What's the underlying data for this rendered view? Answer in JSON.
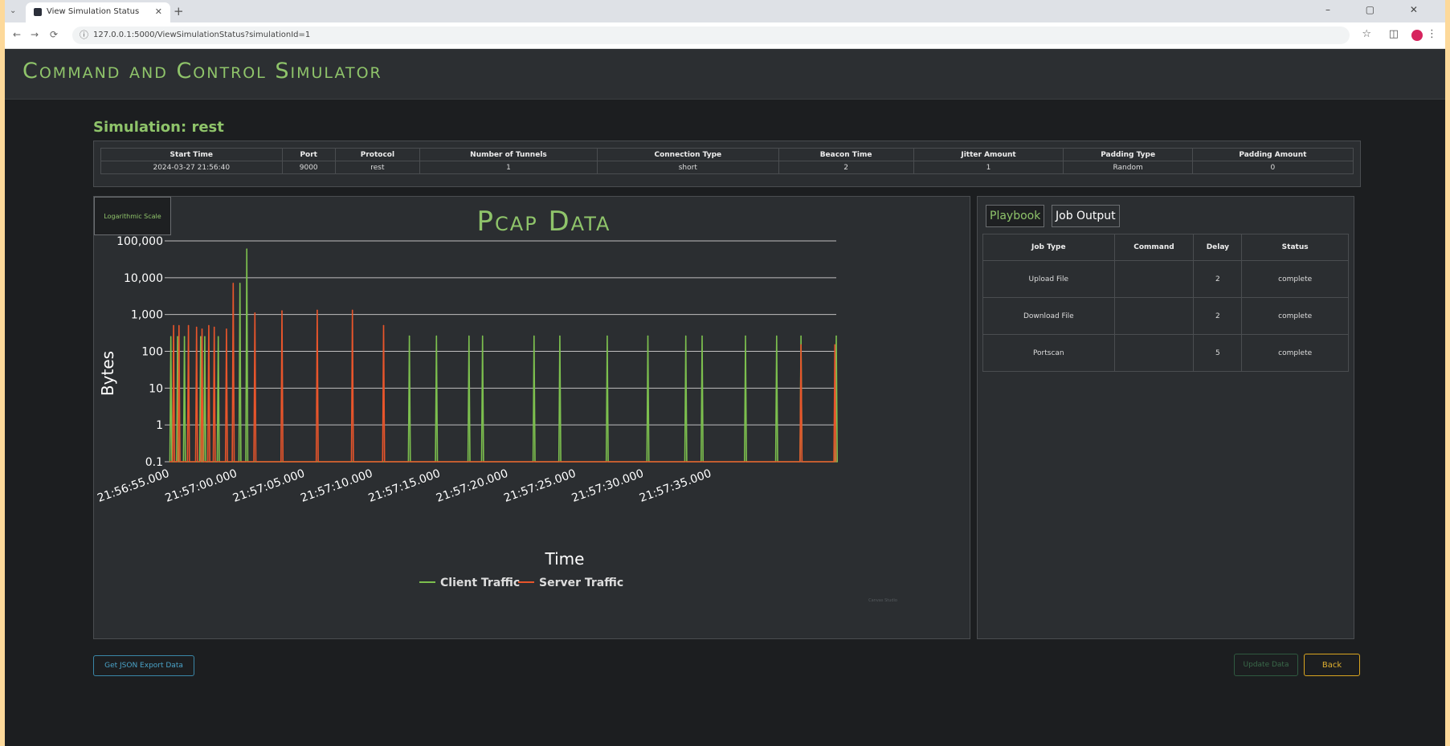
{
  "browser": {
    "tab_title": "View Simulation Status",
    "tab_close": "✕",
    "new_tab": "+",
    "window_controls": "–  ▢  ✕",
    "url": "127.0.0.1:5000/ViewSimulationStatus?simulationId=1",
    "nav": {
      "back": "←",
      "forward": "→",
      "reload": "⟳",
      "info": "ⓘ",
      "star": "☆",
      "sidebar": "◫",
      "menu": "⋮"
    }
  },
  "app": {
    "title": "Command and Control Simulator"
  },
  "simulation": {
    "title": "Simulation: rest",
    "headers": [
      "Start Time",
      "Port",
      "Protocol",
      "Number of Tunnels",
      "Connection Type",
      "Beacon Time",
      "Jitter Amount",
      "Padding Type",
      "Padding Amount"
    ],
    "row": [
      "2024-03-27 21:56:40",
      "9000",
      "rest",
      "1",
      "short",
      "2",
      "1",
      "Random",
      "0"
    ]
  },
  "chart_panel": {
    "log_button": "Logarithmic Scale",
    "watermark": "Canvas Studio"
  },
  "chart_data": {
    "type": "line",
    "title": "Pcap Data",
    "xlabel": "Time",
    "ylabel": "Bytes",
    "yscale": "log",
    "ylim": [
      0.1,
      100000
    ],
    "y_ticks": [
      "100,000",
      "10,000",
      "1,000",
      "100",
      "10",
      "1",
      "0.1"
    ],
    "x_ticks": [
      "21:56:55.000",
      "21:57:00.000",
      "21:57:05.000",
      "21:57:10.000",
      "21:57:15.000",
      "21:57:20.000",
      "21:57:25.000",
      "21:57:30.000",
      "21:57:35.000"
    ],
    "x_tick_seconds": [
      55,
      60,
      65,
      70,
      75,
      80,
      85,
      90,
      95
    ],
    "xlim_seconds": [
      55.2,
      104.4
    ],
    "legend": "bottom-center",
    "grid": true,
    "series": [
      {
        "name": "Client Traffic",
        "color": "#7cbf4e",
        "x_seconds": [
          55.3,
          55.8,
          56.3,
          57.5,
          57.8,
          58.8,
          60.4,
          60.9,
          72.9,
          74.9,
          77.3,
          78.3,
          82.1,
          84.0,
          87.5,
          90.5,
          93.3,
          94.5,
          97.7,
          100.0,
          101.8,
          104.4
        ],
        "y": [
          250,
          250,
          250,
          250,
          250,
          250,
          7000,
          60000,
          260,
          260,
          260,
          260,
          260,
          260,
          260,
          260,
          260,
          260,
          260,
          260,
          260,
          260
        ]
      },
      {
        "name": "Server Traffic",
        "color": "#e8552b",
        "x_seconds": [
          55.5,
          55.9,
          56.6,
          57.2,
          57.6,
          58.1,
          58.5,
          59.4,
          59.9,
          61.5,
          63.5,
          66.1,
          68.7,
          71.0,
          101.8,
          104.3
        ],
        "y": [
          500,
          500,
          500,
          450,
          400,
          500,
          450,
          400,
          7000,
          1100,
          1250,
          1300,
          1300,
          500,
          150,
          150
        ]
      }
    ]
  },
  "playbook": {
    "tabs": [
      "Playbook",
      "Job Output"
    ],
    "headers": [
      "Job Type",
      "Command",
      "Delay",
      "Status"
    ],
    "rows": [
      [
        "Upload File",
        "",
        "2",
        "complete"
      ],
      [
        "Download File",
        "",
        "2",
        "complete"
      ],
      [
        "Portscan",
        "",
        "5",
        "complete"
      ]
    ]
  },
  "buttons": {
    "json_export": "Get JSON Export Data",
    "update": "Update Data",
    "back": "Back"
  }
}
